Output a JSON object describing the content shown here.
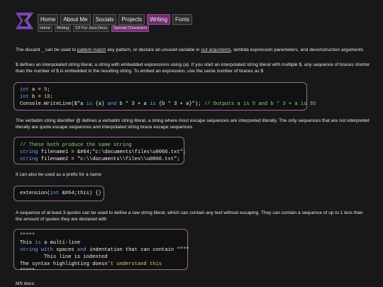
{
  "header": {
    "nav": [
      "Home",
      "About Me",
      "Socials",
      "Projects",
      "Writing",
      "Fonts"
    ],
    "nav_active_index": 4,
    "breadcrumbs": [
      "Home",
      "Writing",
      "C# For Java Devs",
      "Special Characters"
    ]
  },
  "paragraphs": {
    "discard_1": "The discard ",
    "discard_underscore": "_",
    "discard_2": " can be used to ",
    "discard_link1": "pattern match",
    "discard_3": " any pattern, or declare an unused variable in ",
    "discard_link2": "out arguments",
    "discard_4": ", lambda expression parameters, and deconstruction arguments",
    "dollar": "$ defines an interpolated string literal, a string with embedded expressions using {a}. If you start an interpolated string literal with multiple $, any sequence of braces shorter than the number of $ is embedded in the resulting string. To embed an expression, use the same number of braces as $",
    "verbatim": "The verbatim string identifier @ defines a verbatim string literal, a string where most escape sequences are interpreted literally. The only sequences that are not interpreted literally are quote escape sequences and interpolated string brace escape sequences",
    "prefix": "It can also be used as a prefix for a name",
    "raw": "A sequence of at least 3 quotes can be used to define a raw string literal, which can contain any text without escaping. They can contain a sequence of up to 1 less than the amount of quotes they are declared with",
    "ms_docs": "MS docs:"
  },
  "code": {
    "block1": {
      "line1_kw": "int",
      "line1_rest": " a = ",
      "line1_num": "5",
      "line1_end": ";",
      "line2_kw": "int",
      "line2_rest": " b = ",
      "line2_num": "10",
      "line2_end": ";",
      "line3_a": "Console.WriteLine($\"a ",
      "line3_b": "is",
      "line3_c": " {a} ",
      "line3_d": "and",
      "line3_e": " b * 3 + a ",
      "line3_f": "is",
      "line3_g": " {b * 3 + a}\");",
      "line3_comment": " // Outputs a is 5 and b * 3 + a is 35"
    },
    "block2": {
      "comment": "// These both produce the same string",
      "l2_kw": "string",
      "l2_rest": " filename1 = &#64;\"c:\\documents\\files\\u0066.txt\";",
      "l3_kw": "string",
      "l3_rest": " filename2 = \"c:\\\\documents\\\\files\\\\u0066.txt\";"
    },
    "block3": {
      "pre": "extension(",
      "kw": "int",
      "post": " &#64;this) {}"
    },
    "block4": {
      "l1": "\"\"\"\"\"",
      "l2_a": "This ",
      "l2_b": "is",
      "l2_c": " a multi-line",
      "l3_a": "string",
      "l3_b": " with",
      "l3_c": " spaces ",
      "l3_d": "and",
      "l3_e": " indentation that can contain \"\"\"\"",
      "l4": "        This line is indented",
      "l5_a": "The syntax highlighting doesn",
      "l5_b": "'t understand this",
      "l6": "\"\"\"\"\""
    }
  },
  "colors": {
    "accent": "#6f2f6f",
    "border": "#9b6a9b",
    "keyword": "#6fa3ff",
    "number": "#f0c37a",
    "string": "#9ee37d"
  }
}
